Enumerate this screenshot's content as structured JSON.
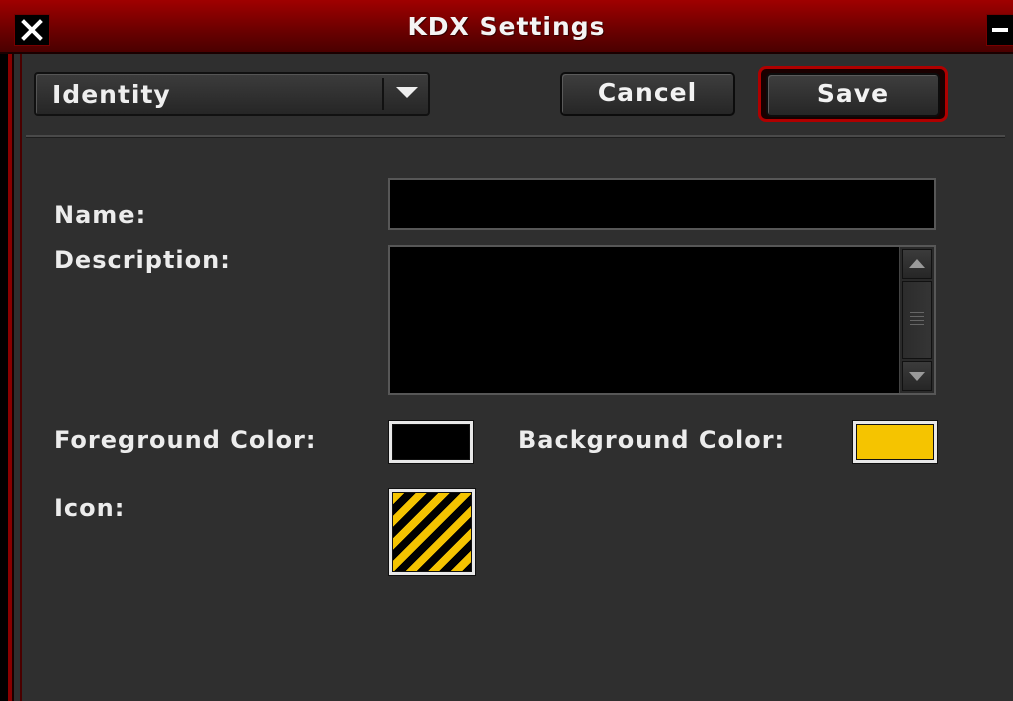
{
  "window": {
    "title": "KDX Settings"
  },
  "toolbar": {
    "section_select": {
      "selected": "Identity"
    },
    "cancel_label": "Cancel",
    "save_label": "Save"
  },
  "form": {
    "name_label": "Name:",
    "name_value": "",
    "description_label": "Description:",
    "description_value": "",
    "foreground_label": "Foreground Color:",
    "foreground_color": "#000000",
    "background_label": "Background Color:",
    "background_color": "#f5c400",
    "icon_label": "Icon:",
    "icon_name": "hazard-stripes-icon"
  },
  "colors": {
    "titlebar": "#8a0000",
    "accent": "#b00000",
    "panel": "#2f2f2f"
  }
}
